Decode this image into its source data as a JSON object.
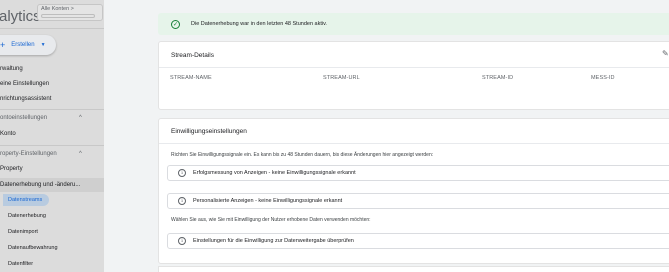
{
  "sidebar": {
    "brand": "alytics",
    "account_label": "Alle Konten >",
    "create_label": "Erstellen",
    "items": [
      {
        "label": "rwaltung"
      },
      {
        "label": "eine Einstellungen"
      },
      {
        "label": "nrichtungsassistent"
      }
    ],
    "account_section": "ontoeinstellungen",
    "account_item": "Konto",
    "property_section": "roperty-Einstellungen",
    "property_item": "Property",
    "data_section": "Datenerhebung und -änderu...",
    "subitems": [
      {
        "label": "Datenstreams",
        "active": true
      },
      {
        "label": "Datenerhebung"
      },
      {
        "label": "Datenimport"
      },
      {
        "label": "Datenaufbewahrung"
      },
      {
        "label": "Datenfilter"
      }
    ]
  },
  "banner": {
    "text": "Die Datenerhebung war in den letzten 48 Stunden aktiv."
  },
  "stream_details": {
    "title": "Stream-Details",
    "columns": [
      "STREAM-NAME",
      "STREAM-URL",
      "STREAM-ID",
      "MESS-ID"
    ]
  },
  "consent": {
    "title": "Einwilligungseinstellungen",
    "description": "Richten Sie Einwilligungssignale ein. Es kann bis zu 48 Stunden dauern, bis diese Änderungen hier angezeigt werden:",
    "rows": [
      {
        "label": "Erfolgsmessung von Anzeigen - keine Einwilligungssignale erkannt"
      },
      {
        "label": "Personalisierte Anzeigen - keine Einwilligungssignale erkannt"
      }
    ],
    "choose_text": "Wählen Sie aus, wie Sie mit Einwilligung der Nutzer erhobene Daten verwenden möchten:",
    "sharing_row": "Einstellungen für die Einwilligung zur Datenweitergabe überprüfen"
  },
  "colors": {
    "banner_bg": "#e6f4ea",
    "success": "#188038",
    "accent": "#1967d2",
    "sidebar_bg": "#dcdcdc"
  }
}
